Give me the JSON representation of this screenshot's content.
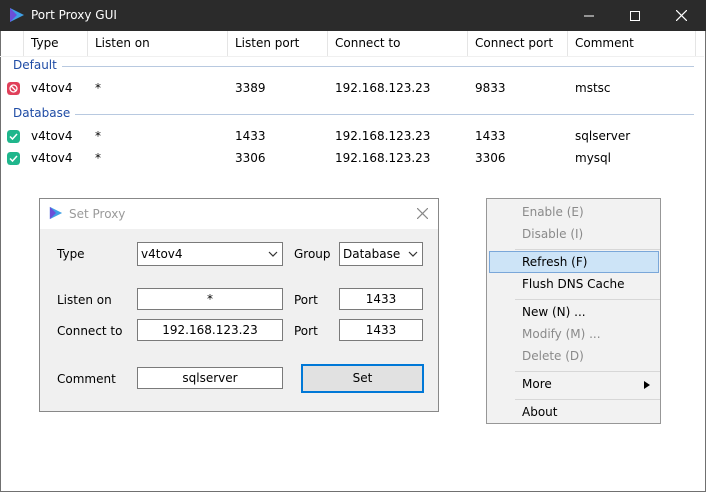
{
  "window": {
    "title": "Port Proxy GUI"
  },
  "columns": [
    "Type",
    "Listen on",
    "Listen port",
    "Connect to",
    "Connect port",
    "Comment"
  ],
  "groups": [
    {
      "name": "Default",
      "rows": [
        {
          "status": "disabled",
          "type": "v4tov4",
          "listen_on": "*",
          "listen_port": "3389",
          "connect_to": "192.168.123.23",
          "connect_port": "9833",
          "comment": "mstsc"
        }
      ]
    },
    {
      "name": "Database",
      "rows": [
        {
          "status": "enabled",
          "type": "v4tov4",
          "listen_on": "*",
          "listen_port": "1433",
          "connect_to": "192.168.123.23",
          "connect_port": "1433",
          "comment": "sqlserver"
        },
        {
          "status": "enabled",
          "type": "v4tov4",
          "listen_on": "*",
          "listen_port": "3306",
          "connect_to": "192.168.123.23",
          "connect_port": "3306",
          "comment": "mysql"
        }
      ]
    }
  ],
  "dialog": {
    "title": "Set Proxy",
    "type_label": "Type",
    "type_value": "v4tov4",
    "group_label": "Group",
    "group_value": "Database",
    "listen_on_label": "Listen on",
    "listen_on_value": "*",
    "port_label": "Port",
    "listen_port_value": "1433",
    "connect_to_label": "Connect to",
    "connect_to_value": "192.168.123.23",
    "connect_port_value": "1433",
    "comment_label": "Comment",
    "comment_value": "sqlserver",
    "set_button": "Set"
  },
  "context_menu": {
    "items": [
      "Enable (E)",
      "Disable (I)",
      "Refresh (F)",
      "Flush DNS Cache",
      "New (N) ...",
      "Modify (M) ...",
      "Delete (D)",
      "More",
      "About"
    ],
    "highlighted": "Refresh (F)"
  },
  "colors": {
    "titlebar": "#2b2b2b",
    "group_text": "#1e4ba5",
    "enabled": "#1fb68c",
    "disabled": "#e0405a",
    "highlight": "#cde4f7"
  }
}
